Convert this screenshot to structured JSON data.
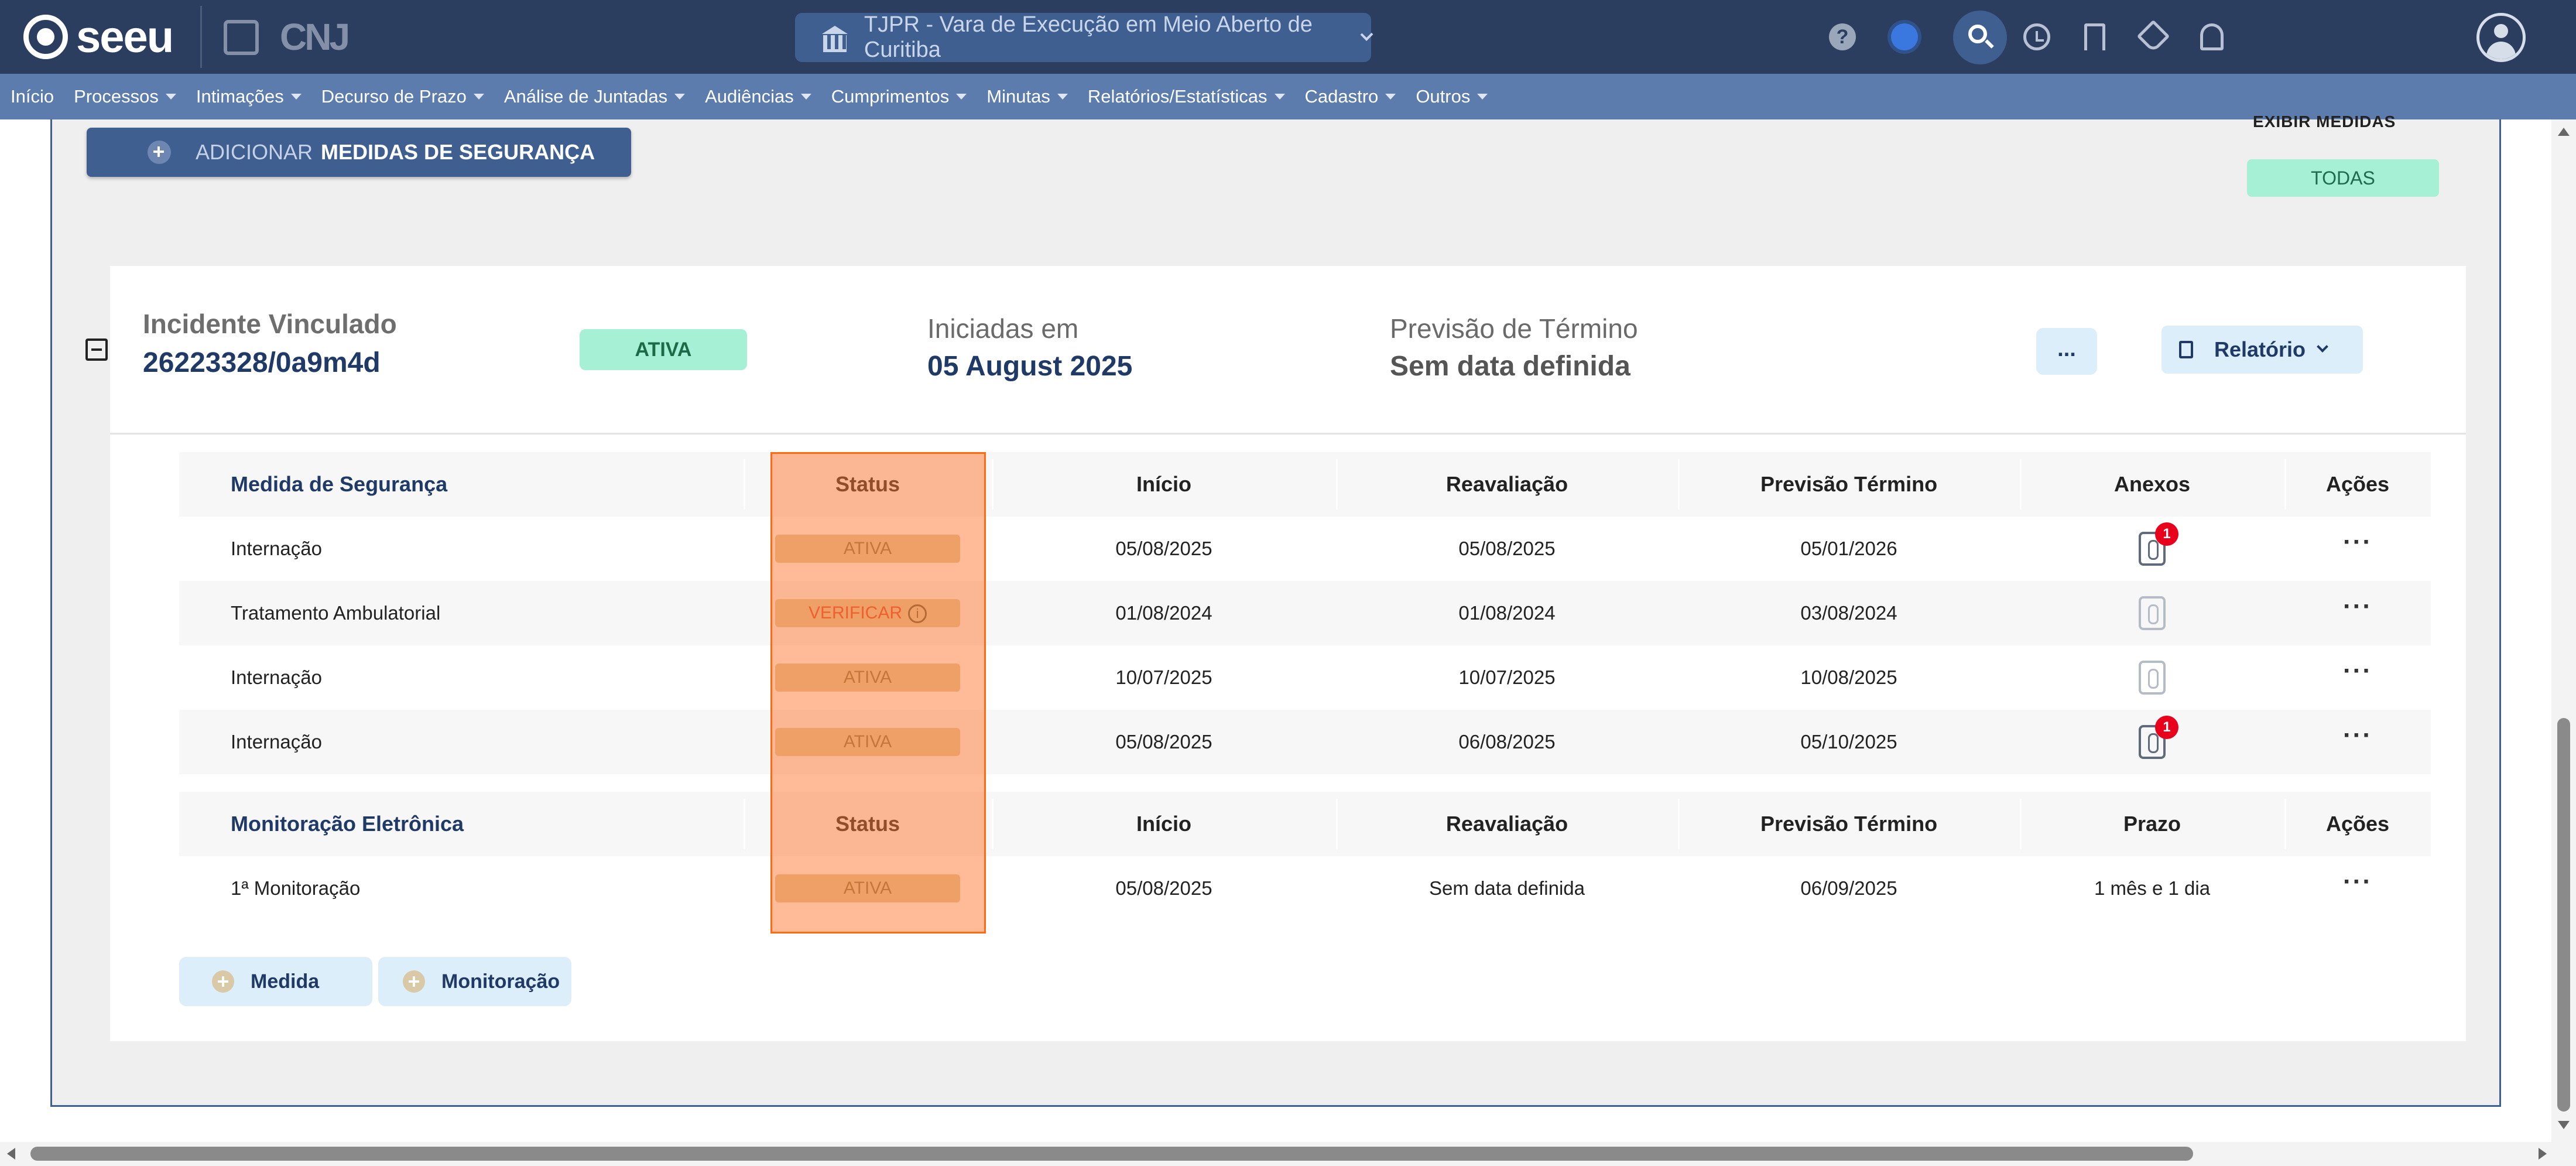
{
  "app": {
    "logo_text": "seeu",
    "cnj_text": "CNJ"
  },
  "court_selector": {
    "value": "TJPR - Vara de Execução em Meio Aberto de Curitiba"
  },
  "toolbar": {
    "help_symbol": "?"
  },
  "menu": [
    {
      "label": "Início",
      "has_caret": false
    },
    {
      "label": "Processos",
      "has_caret": true
    },
    {
      "label": "Intimações",
      "has_caret": true
    },
    {
      "label": "Decurso de Prazo",
      "has_caret": true
    },
    {
      "label": "Análise de Juntadas",
      "has_caret": true
    },
    {
      "label": "Audiências",
      "has_caret": true
    },
    {
      "label": "Cumprimentos",
      "has_caret": true
    },
    {
      "label": "Minutas",
      "has_caret": true
    },
    {
      "label": "Relatórios/Estatísticas",
      "has_caret": true
    },
    {
      "label": "Cadastro",
      "has_caret": true
    },
    {
      "label": "Outros",
      "has_caret": true
    }
  ],
  "actions": {
    "add_prefix": "ADICIONAR",
    "add_bold": "MEDIDAS DE SEGURANÇA",
    "exibir_medidas": "EXIBIR MEDIDAS",
    "filter_all": "TODAS"
  },
  "incident": {
    "label": "Incidente Vinculado",
    "value": "26223328/0a9m4d",
    "status": "ATIVA",
    "started_label": "Iniciadas em",
    "started_value": "05 August 2025",
    "forecast_label": "Previsão de Término",
    "forecast_value": "Sem data definida",
    "more_label": "...",
    "report_label": "Relatório"
  },
  "security_table": {
    "headers": {
      "title": "Medida de Segurança",
      "status": "Status",
      "start": "Início",
      "review": "Reavaliação",
      "end": "Previsão Término",
      "attachments": "Anexos",
      "actions": "Ações"
    },
    "rows": [
      {
        "name": "Internação",
        "status": "ATIVA",
        "start": "05/08/2025",
        "review": "05/08/2025",
        "end": "05/01/2026",
        "attachments": "1",
        "actions": "···"
      },
      {
        "name": "Tratamento Ambulatorial",
        "status": "VERIFICAR",
        "start": "01/08/2024",
        "review": "01/08/2024",
        "end": "03/08/2024",
        "attachments": "",
        "actions": "···"
      },
      {
        "name": "Internação",
        "status": "ATIVA",
        "start": "10/07/2025",
        "review": "10/07/2025",
        "end": "10/08/2025",
        "attachments": "",
        "actions": "···"
      },
      {
        "name": "Internação",
        "status": "ATIVA",
        "start": "05/08/2025",
        "review": "06/08/2025",
        "end": "05/10/2025",
        "attachments": "1",
        "actions": "···"
      }
    ]
  },
  "monitor_table": {
    "headers": {
      "title": "Monitoração Eletrônica",
      "status": "Status",
      "start": "Início",
      "review": "Reavaliação",
      "end": "Previsão Término",
      "term": "Prazo",
      "actions": "Ações"
    },
    "rows": [
      {
        "name": "1ª Monitoração",
        "status": "ATIVA",
        "start": "05/08/2025",
        "review": "Sem data definida",
        "end": "06/09/2025",
        "term": "1 mês e 1 dia",
        "actions": "···"
      }
    ]
  },
  "footer_buttons": {
    "add_measure": "Medida",
    "add_monitoring": "Monitoração"
  },
  "colors": {
    "topbar": "#2b3e5f",
    "menubar": "#5b7cad",
    "active_badge": "#a6f0d6",
    "status_pill": "#dcc89a",
    "verify_text": "#e0472d",
    "highlight": "#ff6a13"
  }
}
